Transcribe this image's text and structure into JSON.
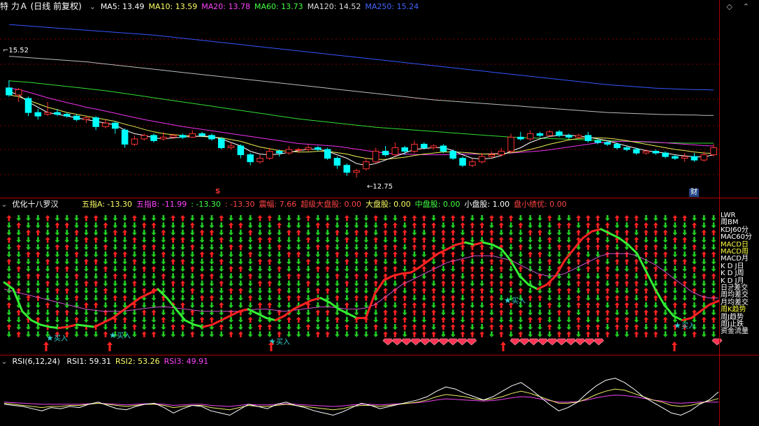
{
  "main_pane": {
    "title": "特 力Ａ (日线 前复权)",
    "indicators": [
      {
        "label": "MA5: 13.49",
        "color": "#ffffff"
      },
      {
        "label": "MA10: 13.59",
        "color": "#ffff66"
      },
      {
        "label": "MA20: 13.78",
        "color": "#ff44ff"
      },
      {
        "label": "MA60: 13.73",
        "color": "#44ff44"
      },
      {
        "label": "MA120: 14.52",
        "color": "#dddddd"
      },
      {
        "label": "MA250: 15.24",
        "color": "#4466ff"
      }
    ],
    "high_label": "15.52",
    "low_label": "12.75",
    "marker_s": "S",
    "marker_cai": "财"
  },
  "mid_pane": {
    "title": "优化十八罗汉",
    "indicators": [
      {
        "label": "五指A: -13.30",
        "color": "#ffff66"
      },
      {
        "label": "五指B: -11.99",
        "color": "#ff44ff"
      },
      {
        "label": ": -13.30",
        "color": "#44ff44"
      },
      {
        "label": ": -13.30",
        "color": "#ff4444"
      },
      {
        "label": "震幅: 7.66",
        "color": "#ff4444"
      },
      {
        "label": "超级大盘股: 0.00",
        "color": "#ff4444"
      },
      {
        "label": "大盘股: 0.00",
        "color": "#ffff66"
      },
      {
        "label": "中盘股: 0.00",
        "color": "#44ff44"
      },
      {
        "label": "小盘股: 1.00",
        "color": "#ffffff"
      },
      {
        "label": "盘小绩优: 0.00",
        "color": "#ff4444"
      }
    ],
    "row_labels": [
      {
        "text": "LWR",
        "color": "#ffffff"
      },
      {
        "text": "周BM",
        "color": "#ffffff"
      },
      {
        "text": "KDJ60分",
        "color": "#ffffff"
      },
      {
        "text": "MAC60分",
        "color": "#ffffff"
      },
      {
        "text": "MACD日",
        "color": "#ffff44"
      },
      {
        "text": "MACD周",
        "color": "#ffff44"
      },
      {
        "text": "MACD月",
        "color": "#ffffff"
      },
      {
        "text": "K D J日",
        "color": "#ffffff"
      },
      {
        "text": "K D J周",
        "color": "#ffffff"
      },
      {
        "text": "K D J月",
        "color": "#ffffff"
      },
      {
        "text": "日균差交",
        "color": "#ffffff"
      },
      {
        "text": "周均差交",
        "color": "#ffffff"
      },
      {
        "text": "月均差交",
        "color": "#ffffff"
      },
      {
        "text": "周K趋势",
        "color": "#ffff44"
      },
      {
        "text": "周J趋势",
        "color": "#ffffff"
      },
      {
        "text": "周J止跌",
        "color": "#ffffff"
      },
      {
        "text": "资金流量",
        "color": "#ffffff"
      }
    ],
    "buy_label": "买入"
  },
  "rsi_pane": {
    "title": "RSI(6,12,24)",
    "indicators": [
      {
        "label": "RSI1: 59.31",
        "color": "#ffffff"
      },
      {
        "label": "RSI2: 53.26",
        "color": "#ffff66"
      },
      {
        "label": "RSI3: 49.91",
        "color": "#ff44ff"
      }
    ]
  },
  "colors": {
    "up": "#ff3333",
    "down": "#00ffff",
    "grid": "#800000",
    "arrow_up": "#ff2222",
    "arrow_down": "#22cc22"
  },
  "candles": [
    [
      15.3,
      15.1,
      15.52,
      15.05
    ],
    [
      15.1,
      15.25,
      15.3,
      14.9
    ],
    [
      15.0,
      14.6,
      15.05,
      14.5
    ],
    [
      14.6,
      14.5,
      14.7,
      14.4
    ],
    [
      14.55,
      14.6,
      14.9,
      14.5
    ],
    [
      14.6,
      14.55,
      14.7,
      14.5
    ],
    [
      14.55,
      14.5,
      14.6,
      14.45
    ],
    [
      14.5,
      14.4,
      14.55,
      14.35
    ],
    [
      14.4,
      14.45,
      14.5,
      14.3
    ],
    [
      14.45,
      14.2,
      14.5,
      14.1
    ],
    [
      14.2,
      14.3,
      14.4,
      14.15
    ],
    [
      14.3,
      14.15,
      14.35,
      14.0
    ],
    [
      14.1,
      13.7,
      14.15,
      13.6
    ],
    [
      13.7,
      13.85,
      13.95,
      13.65
    ],
    [
      13.85,
      13.95,
      14.0,
      13.8
    ],
    [
      13.95,
      13.8,
      14.0,
      13.75
    ],
    [
      13.85,
      13.9,
      14.05,
      13.8
    ],
    [
      13.9,
      13.95,
      14.0,
      13.85
    ],
    [
      13.95,
      13.9,
      14.0,
      13.85
    ],
    [
      13.9,
      14.0,
      14.1,
      13.88
    ],
    [
      14.0,
      13.95,
      14.05,
      13.9
    ],
    [
      13.95,
      13.85,
      14.0,
      13.8
    ],
    [
      13.85,
      13.6,
      13.9,
      13.55
    ],
    [
      13.6,
      13.65,
      13.75,
      13.55
    ],
    [
      13.65,
      13.4,
      13.7,
      13.3
    ],
    [
      13.4,
      13.2,
      13.45,
      13.1
    ],
    [
      13.2,
      13.3,
      13.4,
      13.15
    ],
    [
      13.3,
      13.5,
      13.6,
      13.25
    ],
    [
      13.5,
      13.45,
      13.55,
      13.35
    ],
    [
      13.45,
      13.55,
      13.65,
      13.4
    ],
    [
      13.55,
      13.55,
      13.6,
      13.45
    ],
    [
      13.55,
      13.6,
      13.7,
      13.5
    ],
    [
      13.6,
      13.55,
      13.65,
      13.5
    ],
    [
      13.55,
      13.3,
      13.6,
      13.25
    ],
    [
      13.3,
      13.1,
      13.35,
      13.0
    ],
    [
      13.1,
      12.9,
      13.15,
      12.8
    ],
    [
      12.9,
      12.95,
      13.0,
      12.75
    ],
    [
      13.0,
      13.2,
      13.3,
      12.95
    ],
    [
      13.2,
      13.5,
      13.6,
      13.15
    ],
    [
      13.5,
      13.4,
      13.65,
      13.35
    ],
    [
      13.4,
      13.6,
      13.75,
      13.35
    ],
    [
      13.6,
      13.5,
      13.65,
      13.4
    ],
    [
      13.5,
      13.7,
      13.8,
      13.45
    ],
    [
      13.7,
      13.6,
      13.75,
      13.55
    ],
    [
      13.6,
      13.65,
      13.7,
      13.55
    ],
    [
      13.65,
      13.5,
      13.7,
      13.45
    ],
    [
      13.5,
      13.3,
      13.55,
      13.25
    ],
    [
      13.3,
      13.1,
      13.35,
      13.05
    ],
    [
      13.1,
      13.2,
      13.3,
      13.05
    ],
    [
      13.2,
      13.35,
      13.45,
      13.15
    ],
    [
      13.35,
      13.4,
      13.5,
      13.3
    ],
    [
      13.4,
      13.5,
      13.6,
      13.35
    ],
    [
      13.5,
      13.9,
      14.0,
      13.45
    ],
    [
      13.9,
      13.85,
      14.05,
      13.8
    ],
    [
      13.85,
      14.0,
      14.1,
      13.8
    ],
    [
      14.0,
      13.95,
      14.05,
      13.9
    ],
    [
      13.95,
      14.05,
      14.1,
      13.9
    ],
    [
      14.05,
      13.95,
      14.1,
      13.9
    ],
    [
      13.95,
      13.9,
      14.0,
      13.85
    ],
    [
      13.9,
      13.95,
      14.0,
      13.85
    ],
    [
      13.95,
      13.8,
      14.05,
      13.75
    ],
    [
      13.8,
      13.75,
      13.85,
      13.7
    ],
    [
      13.75,
      13.7,
      13.8,
      13.65
    ],
    [
      13.7,
      13.6,
      13.75,
      13.55
    ],
    [
      13.6,
      13.55,
      13.65,
      13.5
    ],
    [
      13.55,
      13.45,
      13.6,
      13.4
    ],
    [
      13.45,
      13.5,
      13.55,
      13.4
    ],
    [
      13.5,
      13.45,
      13.55,
      13.4
    ],
    [
      13.45,
      13.35,
      13.5,
      13.3
    ],
    [
      13.35,
      13.3,
      13.4,
      13.25
    ],
    [
      13.3,
      13.35,
      13.45,
      13.2
    ],
    [
      13.35,
      13.25,
      13.45,
      13.2
    ],
    [
      13.25,
      13.4,
      13.5,
      13.2
    ],
    [
      13.4,
      13.6,
      13.7,
      13.35
    ]
  ],
  "ma_lines": {
    "ma5": [
      15.2,
      15.1,
      14.9,
      14.75,
      14.6,
      14.55,
      14.5,
      14.45,
      14.4,
      14.35,
      14.3,
      14.25,
      14.1,
      14.0,
      13.95,
      13.88,
      13.85,
      13.88,
      13.9,
      13.92,
      13.93,
      13.92,
      13.85,
      13.75,
      13.65,
      13.5,
      13.42,
      13.4,
      13.42,
      13.47,
      13.52,
      13.55,
      13.56,
      13.5,
      13.4,
      13.3,
      13.15,
      13.1,
      13.15,
      13.25,
      13.35,
      13.45,
      13.55,
      13.58,
      13.6,
      13.6,
      13.52,
      13.4,
      13.3,
      13.28,
      13.3,
      13.38,
      13.5,
      13.6,
      13.75,
      13.85,
      13.92,
      13.95,
      13.96,
      13.93,
      13.9,
      13.85,
      13.8,
      13.72,
      13.65,
      13.58,
      13.52,
      13.48,
      13.45,
      13.4,
      13.37,
      13.34,
      13.34,
      13.4
    ],
    "ma10": [
      15.1,
      15.05,
      14.95,
      14.85,
      14.75,
      14.68,
      14.6,
      14.55,
      14.5,
      14.45,
      14.4,
      14.35,
      14.27,
      14.2,
      14.12,
      14.05,
      14.0,
      13.97,
      13.95,
      13.93,
      13.92,
      13.9,
      13.88,
      13.83,
      13.78,
      13.7,
      13.62,
      13.57,
      13.52,
      13.5,
      13.48,
      13.48,
      13.5,
      13.5,
      13.46,
      13.42,
      13.35,
      13.3,
      13.27,
      13.27,
      13.3,
      13.33,
      13.38,
      13.42,
      13.45,
      13.48,
      13.48,
      13.47,
      13.45,
      13.42,
      13.42,
      13.43,
      13.46,
      13.5,
      13.55,
      13.62,
      13.7,
      13.76,
      13.82,
      13.86,
      13.88,
      13.88,
      13.87,
      13.84,
      13.8,
      13.75,
      13.7,
      13.65,
      13.6,
      13.55,
      13.52,
      13.48,
      13.45,
      13.44
    ],
    "ma20": [
      15.3,
      15.25,
      15.18,
      15.1,
      15.02,
      14.95,
      14.88,
      14.82,
      14.75,
      14.7,
      14.64,
      14.58,
      14.52,
      14.46,
      14.4,
      14.35,
      14.3,
      14.25,
      14.2,
      14.16,
      14.12,
      14.08,
      14.04,
      14.0,
      13.96,
      13.92,
      13.88,
      13.84,
      13.8,
      13.76,
      13.72,
      13.7,
      13.68,
      13.66,
      13.64,
      13.6,
      13.56,
      13.52,
      13.48,
      13.45,
      13.43,
      13.42,
      13.41,
      13.4,
      13.4,
      13.4,
      13.41,
      13.42,
      13.42,
      13.42,
      13.43,
      13.44,
      13.45,
      13.47,
      13.49,
      13.51,
      13.54,
      13.58,
      13.62,
      13.66,
      13.7,
      13.74,
      13.76,
      13.78,
      13.78,
      13.78,
      13.77,
      13.76,
      13.74,
      13.72,
      13.7,
      13.68,
      13.66,
      13.65
    ],
    "ma60": [
      15.5,
      15.48,
      15.46,
      15.43,
      15.4,
      15.37,
      15.34,
      15.31,
      15.28,
      15.25,
      15.22,
      15.18,
      15.14,
      15.1,
      15.06,
      15.02,
      14.98,
      14.94,
      14.9,
      14.86,
      14.82,
      14.78,
      14.74,
      14.7,
      14.66,
      14.62,
      14.58,
      14.54,
      14.5,
      14.46,
      14.42,
      14.39,
      14.36,
      14.33,
      14.3,
      14.27,
      14.24,
      14.21,
      14.18,
      14.16,
      14.14,
      14.12,
      14.1,
      14.08,
      14.06,
      14.04,
      14.02,
      14.0,
      13.98,
      13.96,
      13.94,
      13.92,
      13.9,
      13.89,
      13.88,
      13.87,
      13.86,
      13.85,
      13.84,
      13.83,
      13.82,
      13.81,
      13.8,
      13.79,
      13.78,
      13.77,
      13.76,
      13.75,
      13.74,
      13.74,
      13.73,
      13.73,
      13.73,
      13.73
    ],
    "ma120": [
      16.2,
      16.18,
      16.16,
      16.14,
      16.12,
      16.1,
      16.08,
      16.06,
      16.04,
      16.01,
      15.98,
      15.95,
      15.92,
      15.89,
      15.86,
      15.83,
      15.8,
      15.77,
      15.74,
      15.71,
      15.68,
      15.65,
      15.62,
      15.59,
      15.56,
      15.53,
      15.5,
      15.47,
      15.44,
      15.41,
      15.38,
      15.35,
      15.32,
      15.29,
      15.26,
      15.23,
      15.2,
      15.17,
      15.14,
      15.11,
      15.08,
      15.05,
      15.02,
      14.99,
      14.96,
      14.94,
      14.92,
      14.9,
      14.88,
      14.86,
      14.84,
      14.82,
      14.8,
      14.78,
      14.76,
      14.74,
      14.72,
      14.7,
      14.68,
      14.66,
      14.64,
      14.62,
      14.6,
      14.59,
      14.58,
      14.57,
      14.56,
      14.55,
      14.54,
      14.54,
      14.53,
      14.53,
      14.52,
      14.52
    ],
    "ma250": [
      17.1,
      17.08,
      17.06,
      17.04,
      17.02,
      17.0,
      16.98,
      16.96,
      16.94,
      16.92,
      16.9,
      16.88,
      16.86,
      16.84,
      16.82,
      16.8,
      16.77,
      16.74,
      16.71,
      16.68,
      16.65,
      16.62,
      16.59,
      16.56,
      16.53,
      16.5,
      16.47,
      16.44,
      16.41,
      16.38,
      16.35,
      16.32,
      16.29,
      16.26,
      16.23,
      16.2,
      16.17,
      16.14,
      16.11,
      16.08,
      16.05,
      16.02,
      15.99,
      15.96,
      15.93,
      15.9,
      15.87,
      15.84,
      15.81,
      15.78,
      15.75,
      15.72,
      15.69,
      15.66,
      15.63,
      15.6,
      15.57,
      15.54,
      15.51,
      15.48,
      15.45,
      15.42,
      15.39,
      15.37,
      15.35,
      15.33,
      15.31,
      15.29,
      15.28,
      15.27,
      15.26,
      15.25,
      15.25,
      15.24
    ]
  },
  "mid_lines": {
    "green": [
      -5,
      -8,
      -18,
      -22,
      -24,
      -25,
      -25.5,
      -25,
      -24,
      -24.5,
      -25,
      -23,
      -21,
      -18,
      -15,
      -12,
      -10,
      -8,
      -12,
      -17,
      -22,
      -24,
      -25,
      -24,
      -22,
      -20,
      -18,
      -17,
      -19,
      -21,
      -22,
      -20,
      -17,
      -15,
      -13,
      -12,
      -14,
      -17,
      -19,
      -21,
      -21,
      -10,
      -4,
      -2,
      -1,
      -0.5,
      2,
      5,
      8,
      10,
      12,
      13,
      12,
      13,
      12,
      10,
      5,
      -2,
      -6,
      -8,
      -6,
      -2,
      5,
      10,
      15,
      18,
      19,
      17,
      15,
      12,
      8,
      0,
      -8,
      -15,
      -20,
      -22,
      -21,
      -18,
      -15,
      -13.3
    ],
    "purple": [
      -8,
      -9,
      -10,
      -11,
      -12,
      -13,
      -14,
      -15,
      -16,
      -17,
      -17.5,
      -18,
      -18,
      -18,
      -17.5,
      -17,
      -16.5,
      -16,
      -16,
      -16.5,
      -17,
      -17.5,
      -18,
      -18,
      -18,
      -18,
      -18,
      -17.5,
      -17,
      -17,
      -17.5,
      -18,
      -17.5,
      -17,
      -16.5,
      -16,
      -16,
      -16.5,
      -17,
      -17,
      -16.5,
      -15,
      -12,
      -9,
      -6,
      -4,
      -2,
      0,
      2,
      4,
      5,
      6,
      7,
      7,
      7,
      6,
      5,
      3,
      1,
      -1,
      -2,
      -2,
      -1,
      1,
      3,
      5,
      7,
      8,
      8,
      8,
      7,
      5,
      3,
      0,
      -3,
      -6,
      -9,
      -11,
      -12,
      -12
    ]
  },
  "rsi_lines": {
    "rsi1": [
      48,
      47,
      46,
      44,
      42,
      45,
      44,
      46,
      45,
      48,
      50,
      47,
      44,
      43,
      46,
      48,
      49,
      45,
      40,
      44,
      47,
      46,
      42,
      40,
      38,
      43,
      48,
      46,
      44,
      48,
      50,
      47,
      45,
      42,
      40,
      38,
      41,
      45,
      49,
      47,
      44,
      46,
      48,
      50,
      52,
      55,
      60,
      64,
      62,
      58,
      55,
      52,
      55,
      60,
      65,
      68,
      62,
      55,
      48,
      42,
      45,
      50,
      58,
      65,
      70,
      72,
      68,
      62,
      55,
      50,
      45,
      40,
      38,
      42,
      48,
      52,
      59.31
    ],
    "rsi2": [
      49,
      48,
      47,
      46,
      45,
      46,
      46,
      47,
      47,
      48,
      49,
      48,
      47,
      46,
      47,
      48,
      48,
      47,
      45,
      46,
      47,
      47,
      45,
      44,
      43,
      45,
      47,
      46,
      46,
      47,
      48,
      47,
      46,
      45,
      44,
      43,
      44,
      46,
      47,
      47,
      46,
      47,
      48,
      49,
      50,
      52,
      55,
      57,
      56,
      55,
      53,
      52,
      53,
      55,
      58,
      60,
      58,
      55,
      52,
      49,
      49,
      50,
      53,
      57,
      60,
      62,
      61,
      58,
      55,
      52,
      50,
      47,
      46,
      47,
      49,
      51,
      53.26
    ],
    "rsi3": [
      50,
      49.5,
      49,
      48.5,
      48,
      48,
      48,
      48,
      48,
      48.5,
      49,
      48.5,
      48,
      47.5,
      48,
      48.5,
      48.5,
      48,
      47,
      47.5,
      48,
      48,
      47,
      46.5,
      46,
      47,
      48,
      47.5,
      47.5,
      48,
      48.5,
      48,
      47.5,
      47,
      46.5,
      46,
      46.5,
      47.5,
      48,
      48,
      47.5,
      48,
      48.5,
      49,
      49.5,
      50.5,
      52,
      53,
      52.5,
      52,
      51.5,
      51,
      51.5,
      52.5,
      54,
      55,
      54.5,
      53,
      51.5,
      50,
      50,
      50.5,
      52,
      54,
      55.5,
      56.5,
      56,
      55,
      53.5,
      52,
      51,
      49.5,
      49,
      49.5,
      50,
      50,
      49.91
    ]
  }
}
